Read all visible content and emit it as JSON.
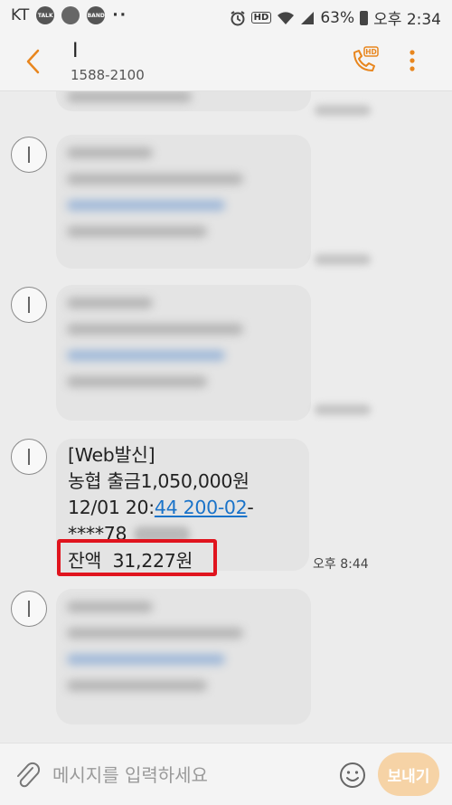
{
  "status_bar": {
    "carrier": "KT",
    "notif1": "TALK",
    "notif2": "BAND",
    "more": "··",
    "hd": "HD",
    "battery_percent": "63%",
    "time": "오후 2:34"
  },
  "header": {
    "contact_name": "I",
    "contact_number": "1588-2100",
    "call_hd_badge": "HD",
    "icons": {
      "back": "chevron-left-icon",
      "call": "phone-hd-icon",
      "more": "more-vertical-icon"
    }
  },
  "messages": {
    "highlighted": {
      "line1": "[Web발신]",
      "line2": "농협 출금1,050,000원",
      "line3_prefix": "12/01 20:",
      "line3_link": "44 200-02",
      "line3_suffix": "-",
      "line4": "****78",
      "balance": "잔액  31,227원",
      "time": "오후 8:44"
    }
  },
  "input_bar": {
    "placeholder": "메시지를 입력하세요",
    "send_label": "보내기",
    "icons": {
      "attach": "paperclip-icon",
      "emoji": "smiley-icon"
    }
  },
  "colors": {
    "accent": "#e8861e",
    "highlight": "#e0141e",
    "link": "#1a73c9",
    "send_button": "#f6d3a6"
  }
}
